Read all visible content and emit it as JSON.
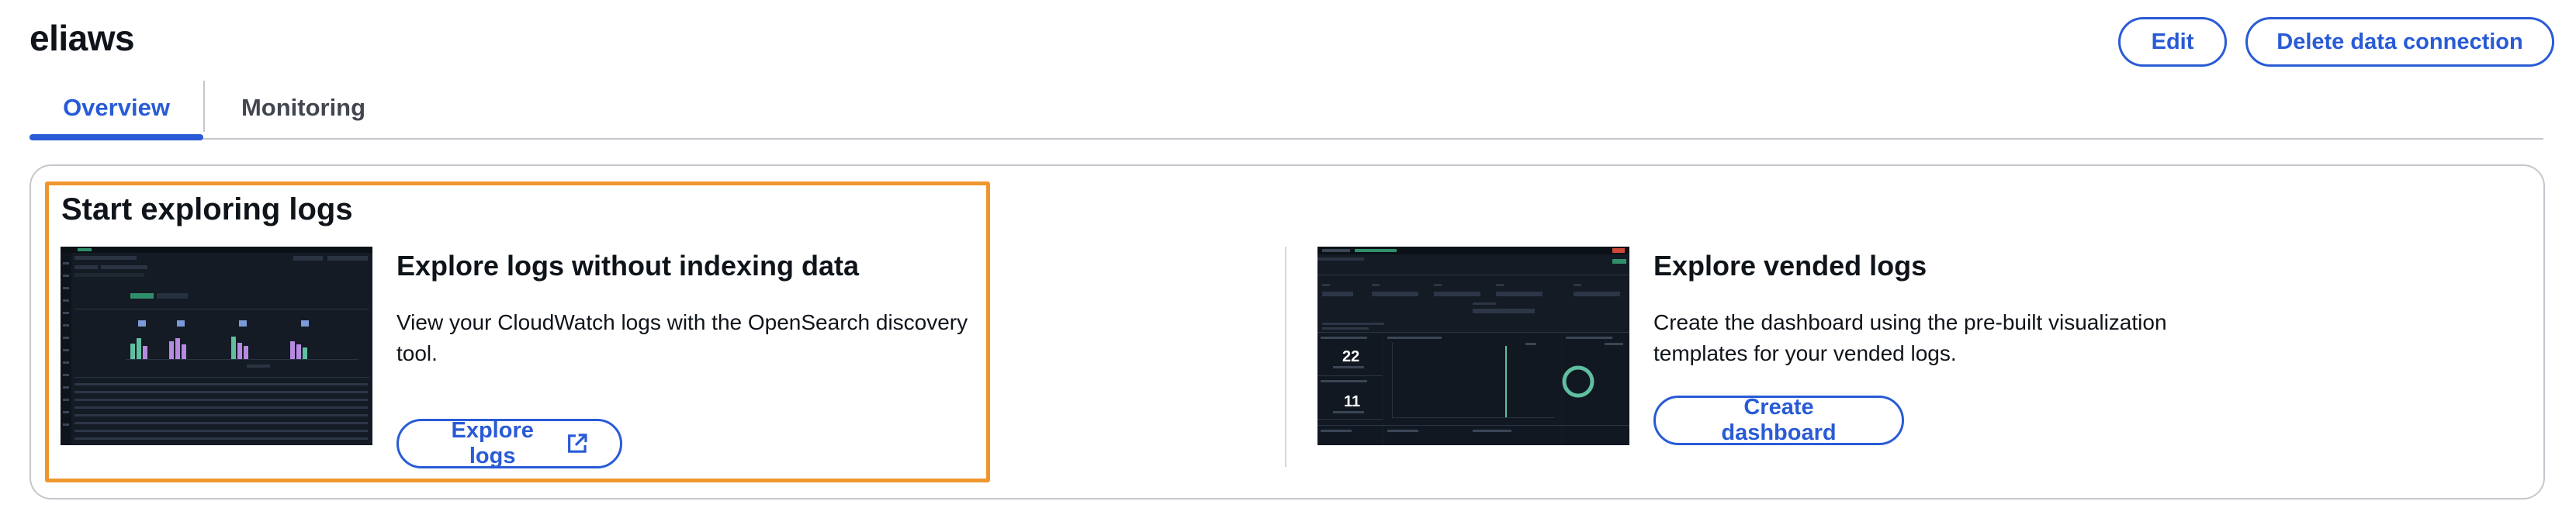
{
  "page": {
    "title": "eliaws"
  },
  "header": {
    "edit_label": "Edit",
    "delete_label": "Delete data connection"
  },
  "tabs": [
    {
      "label": "Overview",
      "selected": true
    },
    {
      "label": "Monitoring",
      "selected": false
    }
  ],
  "start": {
    "heading": "Start exploring logs",
    "explore": {
      "title": "Explore logs without indexing data",
      "description": "View your CloudWatch logs with the OpenSearch discovery tool.",
      "button_label": "Explore logs",
      "button_icon": "external-link-icon"
    },
    "vended": {
      "title": "Explore vended logs",
      "description": "Create the dashboard using the pre-built visualization templates for your vended logs.",
      "button_label": "Create dashboard"
    }
  },
  "thumbnails": {
    "dashboard_metrics": [
      "22",
      "11"
    ]
  },
  "colors": {
    "accent": "#295bd6",
    "highlight": "#f0962e",
    "border": "#c6c6cd",
    "thumb_bg": "#141b24"
  }
}
